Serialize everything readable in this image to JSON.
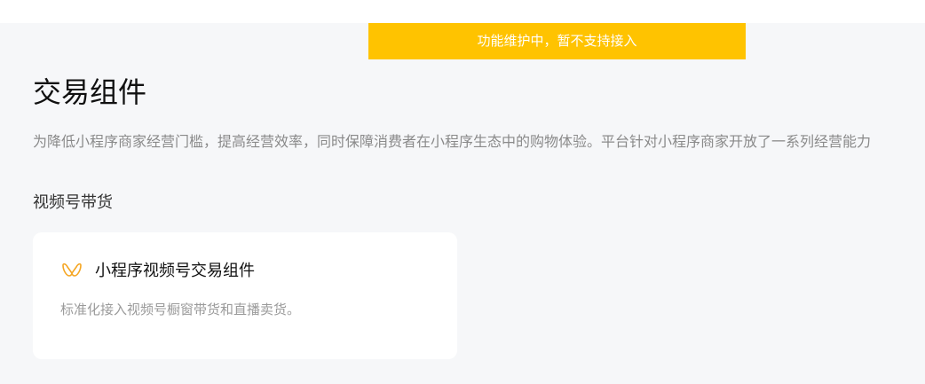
{
  "banner": {
    "text": "功能维护中，暂不支持接入"
  },
  "page": {
    "title": "交易组件",
    "description": "为降低小程序商家经营门槛，提高经营效率，同时保障消费者在小程序生态中的购物体验。平台针对小程序商家开放了一系列经营能力"
  },
  "section": {
    "title": "视频号带货"
  },
  "card": {
    "icon": "channels-icon",
    "title": "小程序视频号交易组件",
    "description": "标准化接入视频号橱窗带货和直播卖货。"
  },
  "colors": {
    "banner_bg": "#ffc300",
    "page_bg": "#f6f7f9",
    "icon_accent": "#f5a623"
  }
}
